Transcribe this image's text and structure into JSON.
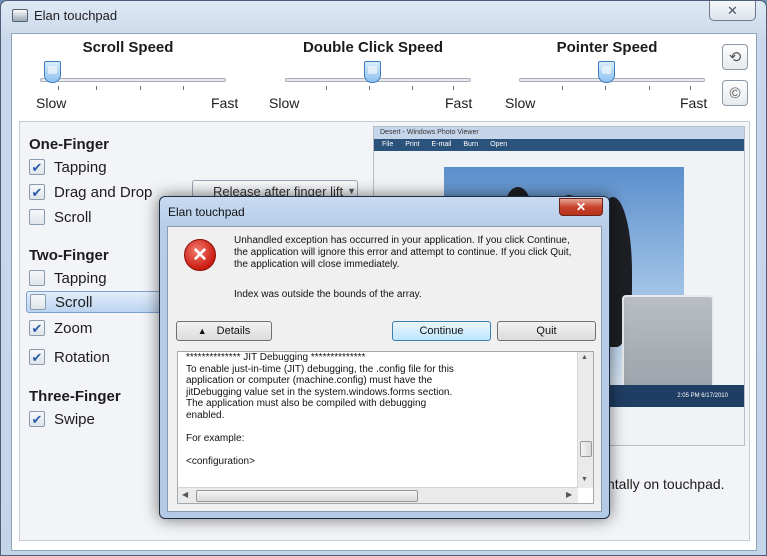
{
  "window": {
    "title": "Elan touchpad",
    "close_glyph": "✕"
  },
  "speeds": [
    {
      "title": "Scroll Speed",
      "slow": "Slow",
      "fast": "Fast",
      "value_fraction": 0.04
    },
    {
      "title": "Double Click Speed",
      "slow": "Slow",
      "fast": "Fast",
      "value_fraction": 0.5
    },
    {
      "title": "Pointer Speed",
      "slow": "Slow",
      "fast": "Fast",
      "value_fraction": 0.5
    }
  ],
  "side_buttons": {
    "reset_glyph": "⟲",
    "about_glyph": "©"
  },
  "one_finger": {
    "heading": "One-Finger",
    "items": [
      {
        "label": "Tapping",
        "checked": true
      },
      {
        "label": "Drag and Drop",
        "checked": true
      },
      {
        "label": "Scroll",
        "checked": false
      }
    ],
    "dropdown_value": "Release after finger lift"
  },
  "two_finger": {
    "heading": "Two-Finger",
    "items": [
      {
        "label": "Tapping",
        "checked": false
      },
      {
        "label": "Scroll",
        "checked": false,
        "selected": true
      },
      {
        "label": "Zoom",
        "checked": true
      },
      {
        "label": "Rotation",
        "checked": true
      }
    ]
  },
  "three_finger": {
    "heading": "Three-Finger",
    "items": [
      {
        "label": "Swipe",
        "checked": true
      }
    ]
  },
  "preview": {
    "window_title": "Desert - Windows Photo Viewer",
    "menu": "File  Print  E-mail  Burn  Open",
    "clock": "2:05 PM  6/17/2010"
  },
  "hint_text": "ntally on touchpad.",
  "dialog": {
    "title": "Elan touchpad",
    "close_glyph": "✕",
    "message": "Unhandled exception has occurred in your application. If you click Continue, the application will ignore this error and attempt to continue. If you click Quit, the application will close immediately.",
    "detail": "Index was outside the bounds of the array.",
    "details_button": "Details",
    "details_glyph": "▲",
    "continue_button": "Continue",
    "quit_button": "Quit",
    "details_text": "************** JIT Debugging **************\nTo enable just-in-time (JIT) debugging, the .config file for this\napplication or computer (machine.config) must have the\njitDebugging value set in the system.windows.forms section.\nThe application must also be compiled with debugging\nenabled.\n\nFor example:\n\n<configuration>"
  }
}
